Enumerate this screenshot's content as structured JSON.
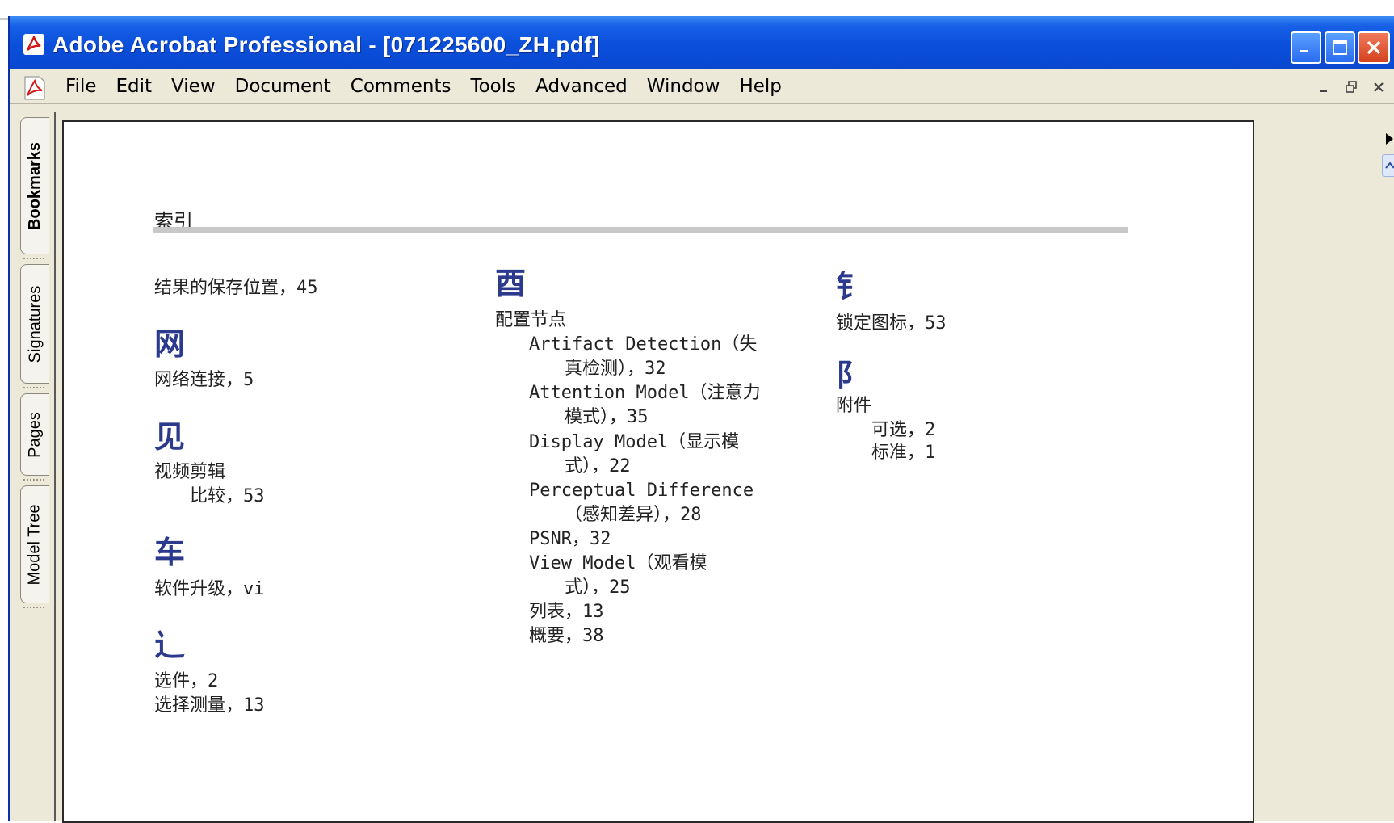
{
  "window": {
    "title": "Adobe Acrobat Professional - [071225600_ZH.pdf]",
    "controls": {
      "minimize": "_",
      "maximize": "□",
      "close": "X"
    }
  },
  "menubar": {
    "items": [
      "File",
      "Edit",
      "View",
      "Document",
      "Comments",
      "Tools",
      "Advanced",
      "Window",
      "Help"
    ],
    "mdi": {
      "minimize": "_",
      "restore": "🗗",
      "close": "X"
    }
  },
  "nav_tabs": [
    "Bookmarks",
    "Signatures",
    "Pages",
    "Model Tree"
  ],
  "right_strip": {
    "arrow": "▶",
    "up": "⌃"
  },
  "page": {
    "title": "索引",
    "col1": {
      "e1": "结果的保存位置，45",
      "h1": "网",
      "e2": "网络连接，5",
      "h2": "见",
      "e3": "视频剪辑",
      "e3a": "比较，53",
      "h3": "车",
      "e4": "软件升级，vi",
      "h4": "辶",
      "e5": "选件，2",
      "e6": "选择测量，13"
    },
    "col2": {
      "h1": "酉",
      "e1": "配置节点",
      "e2a": "Artifact Detection（失",
      "e2b": "真检测），32",
      "e3a": "Attention Model（注意力",
      "e3b": "模式），35",
      "e4a": "Display Model（显示模",
      "e4b": "式），22",
      "e5a": "Perceptual Difference",
      "e5b": "（感知差异），28",
      "e6": "PSNR，32",
      "e7a": "View Model（观看模",
      "e7b": "式），25",
      "e8": "列表，13",
      "e9": "概要，38"
    },
    "col3": {
      "h1": "钅",
      "e1": "锁定图标，53",
      "h2": "阝",
      "e2": "附件",
      "e2a": "可选，2",
      "e2b": "标准，1"
    }
  }
}
